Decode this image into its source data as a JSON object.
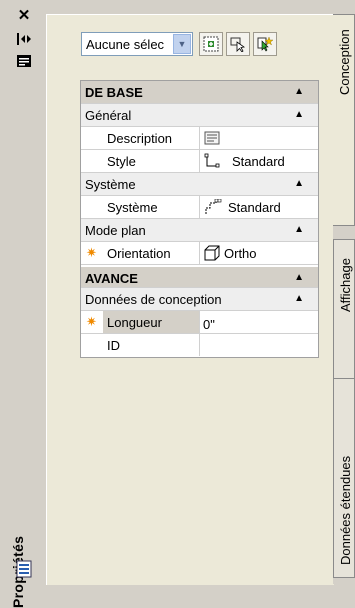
{
  "window": {
    "title": "Propriétés",
    "close_glyph": "✕",
    "autohide_glyph": "⇹",
    "properties_glyph": "▤"
  },
  "toolbar": {
    "selection_value": "Aucune sélection",
    "selection_display": "Aucune sélec",
    "buttons": [
      {
        "name": "toggle-pickadd-icon"
      },
      {
        "name": "select-objects-icon"
      },
      {
        "name": "quick-select-icon"
      }
    ]
  },
  "grid": {
    "sections": [
      {
        "label": "DE BASE",
        "toggle": "▲"
      },
      {
        "label": "AVANCE",
        "toggle": "▲"
      }
    ],
    "categories": [
      {
        "label": "Général",
        "toggle": "▲"
      },
      {
        "label": "Système",
        "toggle": "▲"
      },
      {
        "label": "Mode plan",
        "toggle": "▲"
      },
      {
        "label": "Données de conception",
        "toggle": "▲"
      }
    ],
    "properties": [
      {
        "name": "Description",
        "value": "",
        "icon": "description-icon"
      },
      {
        "name": "Style",
        "value": "Standard",
        "icon": "style-icon"
      },
      {
        "name": "Système",
        "value": "Standard",
        "icon": "system-icon"
      },
      {
        "name": "Orientation",
        "value": "Ortho",
        "icon": "ortho-icon"
      },
      {
        "name": "Longueur",
        "value": "0\""
      },
      {
        "name": "ID",
        "value": ""
      }
    ]
  },
  "tabs": [
    {
      "label": "Conception",
      "active": true
    },
    {
      "label": "Affichage",
      "active": false
    },
    {
      "label": "Données étendues",
      "active": false
    }
  ],
  "colors": {
    "accent_star": "#f08a00",
    "panel_bg": "#ece9d8",
    "frame_bg": "#d4d0c8"
  }
}
